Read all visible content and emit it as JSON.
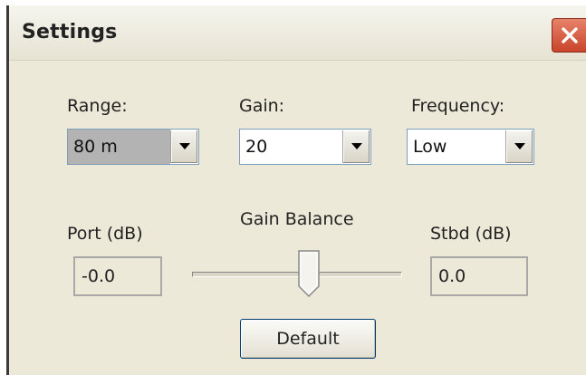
{
  "window": {
    "title": "Settings",
    "close_icon": "close-x-icon",
    "colors": {
      "close_button": "#c8452b",
      "dialog_background": "#ece9d8"
    }
  },
  "range": {
    "label": "Range:",
    "value": "80 m",
    "arrow_icon": "chevron-down-icon"
  },
  "gain": {
    "label": "Gain:",
    "value": "20",
    "arrow_icon": "chevron-down-icon"
  },
  "frequency": {
    "label": "Frequency:",
    "value": "Low",
    "arrow_icon": "chevron-down-icon"
  },
  "port": {
    "label": "Port (dB)",
    "value": "-0.0"
  },
  "gain_balance": {
    "label": "Gain Balance",
    "position_fraction": 0.5
  },
  "stbd": {
    "label": "Stbd (dB)",
    "value": "0.0"
  },
  "buttons": {
    "default_label": "Default"
  }
}
